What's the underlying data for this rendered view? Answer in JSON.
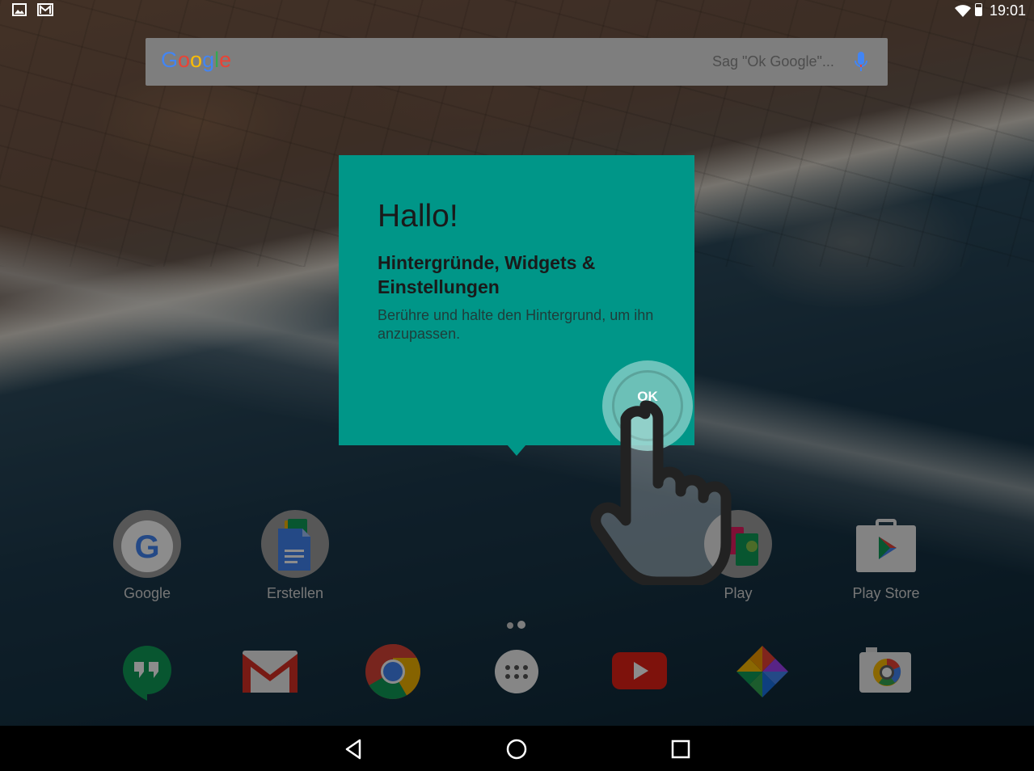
{
  "status_bar": {
    "time": "19:01",
    "left_icons": [
      "image-icon",
      "gmail-notification-icon"
    ],
    "right_icons": [
      "wifi-icon",
      "battery-icon"
    ]
  },
  "search": {
    "logo": [
      "G",
      "o",
      "o",
      "g",
      "l",
      "e"
    ],
    "hint": "Sag \"Ok Google\"...",
    "icon": "mic-icon"
  },
  "cling": {
    "title": "Hallo!",
    "heading": "Hintergründe, Widgets & Einstellungen",
    "body": "Berühre und halte den Hintergrund, um ihn anzupassen.",
    "ok_label": "OK"
  },
  "home_apps": [
    {
      "label": "Google",
      "icon": "google-folder-icon"
    },
    {
      "label": "Erstellen",
      "icon": "docs-folder-icon"
    },
    {
      "label": "Play",
      "icon": "play-folder-icon"
    },
    {
      "label": "Play Store",
      "icon": "play-store-icon"
    }
  ],
  "dock": [
    "hangouts-icon",
    "gmail-icon",
    "chrome-icon",
    "app-drawer-icon",
    "youtube-icon",
    "photos-icon",
    "camera-icon"
  ],
  "nav": [
    "back-icon",
    "home-icon",
    "recents-icon"
  ],
  "colors": {
    "cling": "#009688",
    "accent_ripple": "#80cbc4",
    "google_blue": "#4285F4",
    "google_red": "#EA4335",
    "google_yellow": "#FBBC05",
    "google_green": "#34A853"
  }
}
